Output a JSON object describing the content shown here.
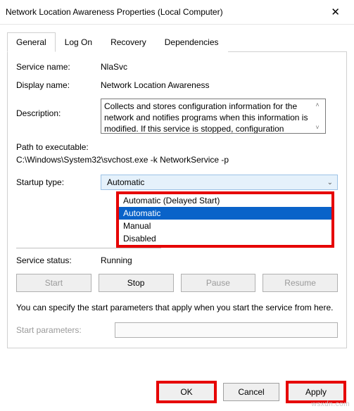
{
  "window": {
    "title": "Network Location Awareness Properties (Local Computer)"
  },
  "tabs": {
    "general": "General",
    "logon": "Log On",
    "recovery": "Recovery",
    "dependencies": "Dependencies"
  },
  "general": {
    "service_name_label": "Service name:",
    "service_name_value": "NlaSvc",
    "display_name_label": "Display name:",
    "display_name_value": "Network Location Awareness",
    "description_label": "Description:",
    "description_value": "Collects and stores configuration information for the network and notifies programs when this information is modified. If this service is stopped, configuration",
    "path_label": "Path to executable:",
    "path_value": "C:\\Windows\\System32\\svchost.exe -k NetworkService -p",
    "startup_type_label": "Startup type:",
    "startup_type_value": "Automatic",
    "startup_options": {
      "delayed": "Automatic (Delayed Start)",
      "auto": "Automatic",
      "manual": "Manual",
      "disabled": "Disabled"
    },
    "service_status_label": "Service status:",
    "service_status_value": "Running",
    "buttons": {
      "start": "Start",
      "stop": "Stop",
      "pause": "Pause",
      "resume": "Resume"
    },
    "hint": "You can specify the start parameters that apply when you start the service from here.",
    "start_params_label": "Start parameters:",
    "start_params_value": ""
  },
  "footer": {
    "ok": "OK",
    "cancel": "Cancel",
    "apply": "Apply"
  },
  "watermark": "wsxdn.com"
}
